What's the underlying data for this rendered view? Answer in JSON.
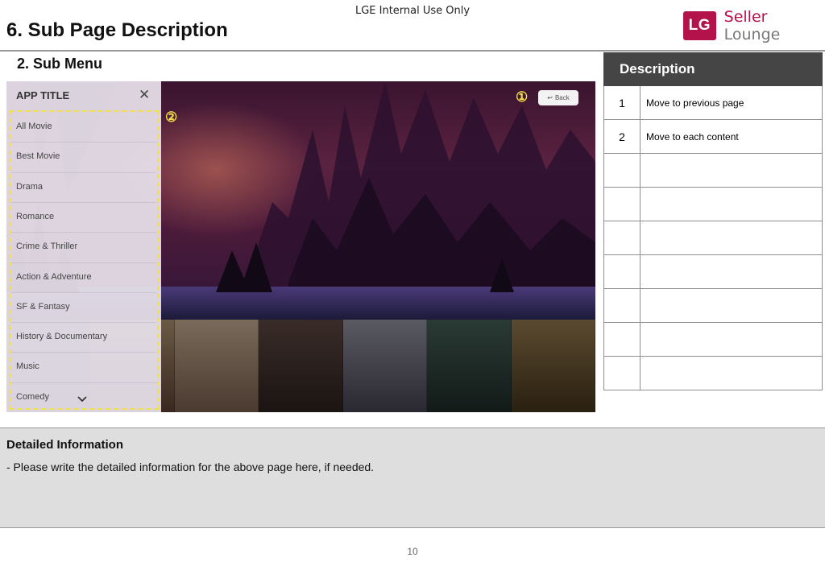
{
  "header": {
    "internal_label": "LGE Internal Use Only",
    "title": "6. Sub Page Description",
    "logo_mark": "LG",
    "logo_brand": "Seller",
    "logo_suffix": "Lounge",
    "brand_color": "#b3124a"
  },
  "section_title": "2. Sub Menu",
  "screen": {
    "menu_title": "APP TITLE",
    "close_icon": "close-icon",
    "menu_items": [
      "All Movie",
      "Best Movie",
      "Drama",
      "Romance",
      "Crime & Thriller",
      "Action & Adventure",
      "SF & Fantasy",
      "History & Documentary",
      "Music",
      "Comedy"
    ],
    "scroll_icon": "chevron-down-icon",
    "back_label": "Back",
    "back_icon": "return-arrow-icon",
    "callouts": [
      "①",
      "②"
    ],
    "callout_color": "#f5e04a"
  },
  "description": {
    "header": "Description",
    "rows": [
      {
        "num": "1",
        "text": "Move to previous page"
      },
      {
        "num": "2",
        "text": "Move to each content"
      },
      {
        "num": "",
        "text": ""
      },
      {
        "num": "",
        "text": ""
      },
      {
        "num": "",
        "text": ""
      },
      {
        "num": "",
        "text": ""
      },
      {
        "num": "",
        "text": ""
      },
      {
        "num": "",
        "text": ""
      },
      {
        "num": "",
        "text": ""
      }
    ]
  },
  "detail": {
    "title": "Detailed Information",
    "body": "- Please write the detailed information for the above page here, if needed."
  },
  "page_number": "10"
}
